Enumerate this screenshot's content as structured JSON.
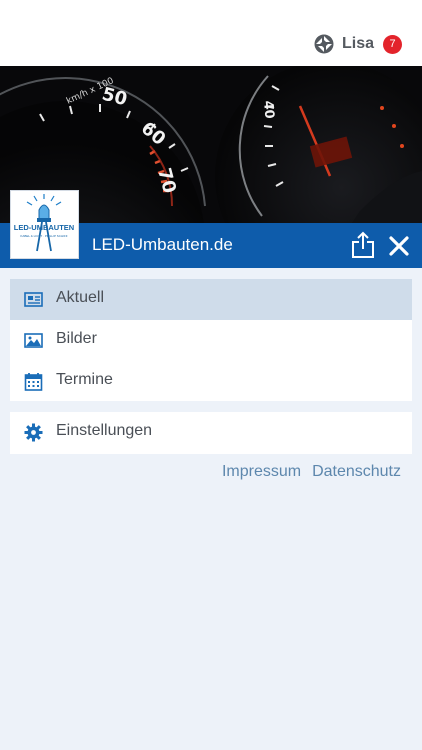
{
  "header": {
    "user_name": "Lisa",
    "notification_count": "7",
    "app_icon": "ultra-app-icon"
  },
  "app": {
    "title": "LED-Umbauten.de",
    "logo_text": "LED-UMBAUTEN",
    "logo_subtext": "KABEL & LICHT · PHILLIP SCHIFF",
    "share_icon": "share-icon",
    "close_icon": "close-icon",
    "brand_color": "#0e5cab"
  },
  "menu": {
    "main_items": [
      {
        "label": "Aktuell",
        "icon": "news-icon",
        "active": true
      },
      {
        "label": "Bilder",
        "icon": "image-icon",
        "active": false
      },
      {
        "label": "Termine",
        "icon": "calendar-icon",
        "active": false
      }
    ],
    "settings_item": {
      "label": "Einstellungen",
      "icon": "gear-icon"
    }
  },
  "footer_links": {
    "impressum": "Impressum",
    "datenschutz": "Datenschutz"
  },
  "hero": {
    "gauge_labels": [
      "40",
      "50",
      "60",
      "70"
    ],
    "gauge_unit": "km/h x 100"
  }
}
